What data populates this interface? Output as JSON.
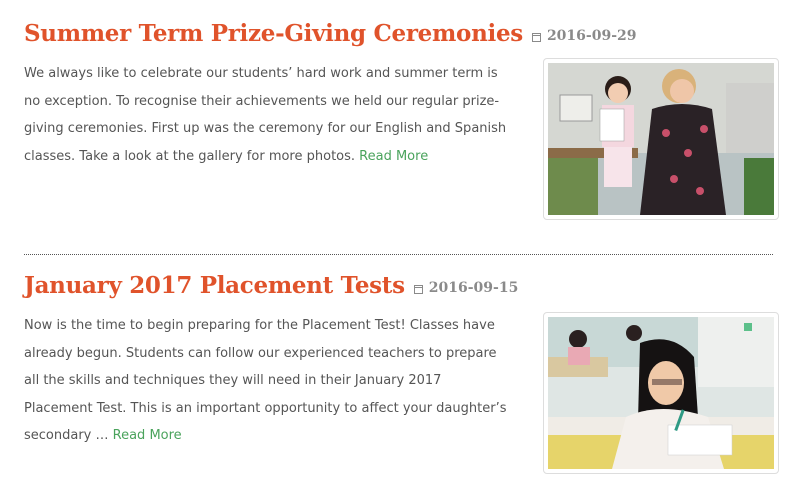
{
  "posts": [
    {
      "title": "Summer Term Prize-Giving Ceremonies",
      "date": "2016-09-29",
      "excerpt": "We always like to celebrate our students’ hard work and summer term is no exception. To recognise their achievements we held our regular prize-giving ceremonies. First up was the ceremony for our English and Spanish classes. Take a look at the gallery for more photos.",
      "read_more": "Read More",
      "image_icon": "photo-teacher-student-certificate"
    },
    {
      "title": "January 2017 Placement Tests",
      "date": "2016-09-15",
      "excerpt": "Now is the time to begin preparing for the Placement Test! Classes have already begun. Students can follow our experienced teachers to prepare all the skills and techniques they will need in their January 2017 Placement Test. This is an important opportunity to affect your daughter’s secondary …",
      "read_more": "Read More",
      "image_icon": "photo-girl-writing"
    }
  ],
  "colors": {
    "title": "#e0532b",
    "link": "#4aa35c",
    "date": "#8a8a8a",
    "text": "#555555"
  }
}
